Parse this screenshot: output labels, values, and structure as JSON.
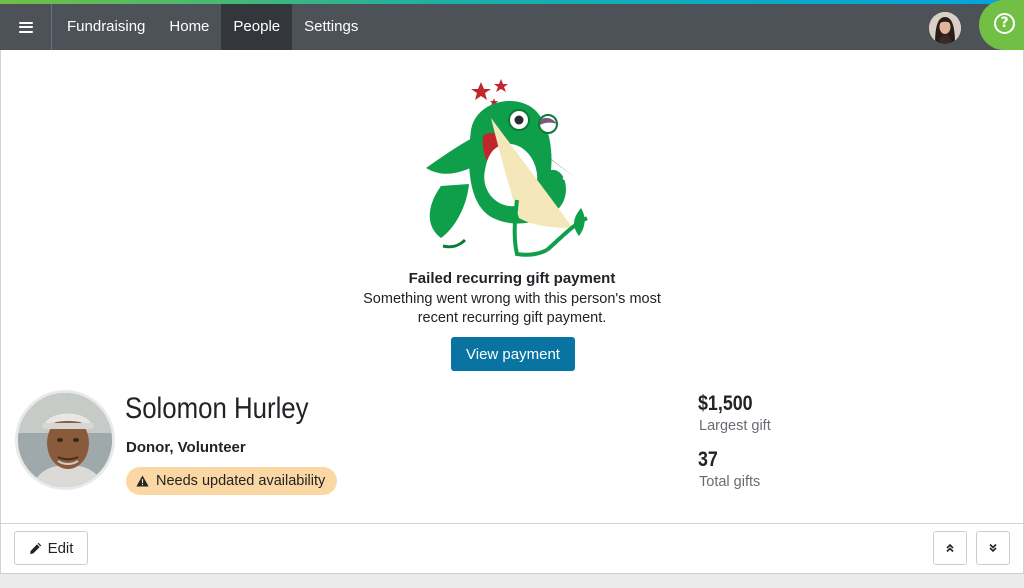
{
  "nav": {
    "items": [
      {
        "label": "Fundraising",
        "active": false
      },
      {
        "label": "Home",
        "active": false
      },
      {
        "label": "People",
        "active": true
      },
      {
        "label": "Settings",
        "active": false
      }
    ],
    "menu_icon": "hamburger-icon",
    "help_icon": "question-circle-icon"
  },
  "alert": {
    "title": "Failed recurring gift payment",
    "message": "Something went wrong with this person's most recent recurring gift payment.",
    "button_label": "View payment",
    "illustration": "dazed-hummingbird-illustration"
  },
  "person": {
    "name": "Solomon Hurley",
    "roles": "Donor, Volunteer",
    "badge": "Needs updated availability",
    "badge_icon": "warning-triangle-icon"
  },
  "stats": [
    {
      "value": "$1,500",
      "label": "Largest gift"
    },
    {
      "value": "37",
      "label": "Total gifts"
    }
  ],
  "footer": {
    "edit_label": "Edit",
    "edit_icon": "pencil-icon",
    "collapse_icon": "double-chevron-up-icon",
    "expand_icon": "double-chevron-down-icon"
  },
  "colors": {
    "accent": "#0974a1",
    "nav_bg": "#4d5259",
    "help_green": "#71bf44",
    "badge_bg": "#fbd7a3"
  }
}
